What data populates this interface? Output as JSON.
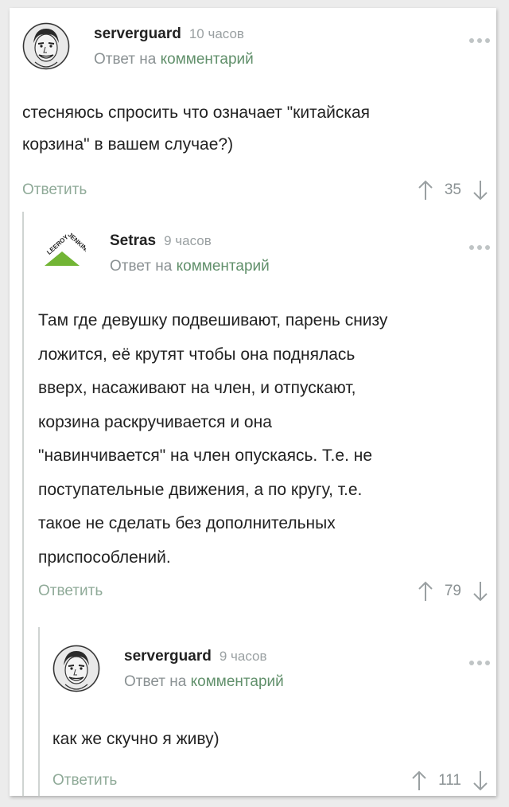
{
  "comments": [
    {
      "author": "serverguard",
      "time": "10 часов",
      "reply_prefix": "Ответ на",
      "reply_link": "комментарий",
      "text": "стесняюсь спросить что означает \"китайская\nкорзина\" в вашем случае?)",
      "reply_label": "Ответить",
      "score": "35",
      "avatar_icon": "caricature-face-avatar"
    },
    {
      "author": "Setras",
      "time": "9 часов",
      "reply_prefix": "Ответ на",
      "reply_link": "комментарий",
      "text": "Там где девушку подвешивают, парень снизу\nложится, её крутят чтобы она поднялась\nвверх, насаживают на член, и отпускают,\nкорзина раскручивается и она\n\"навинчивается\" на член опускаясь. Т.е. не\nпоступательные движения, а по кругу, т.е.\nтакое не сделать без дополнительных\nприспособлений.",
      "reply_label": "Ответить",
      "score": "79",
      "avatar_icon": "leroy-jenkins-logo",
      "avatar_text": "LEEROY JENKINS"
    },
    {
      "author": "serverguard",
      "time": "9 часов",
      "reply_prefix": "Ответ на",
      "reply_link": "комментарий",
      "text": "как же скучно я живу)",
      "reply_label": "Ответить",
      "score": "111",
      "avatar_icon": "caricature-face-avatar"
    }
  ],
  "colors": {
    "accent_green": "#61906b",
    "muted_gray": "#8a9193",
    "thread_line": "#cfd4d2"
  }
}
